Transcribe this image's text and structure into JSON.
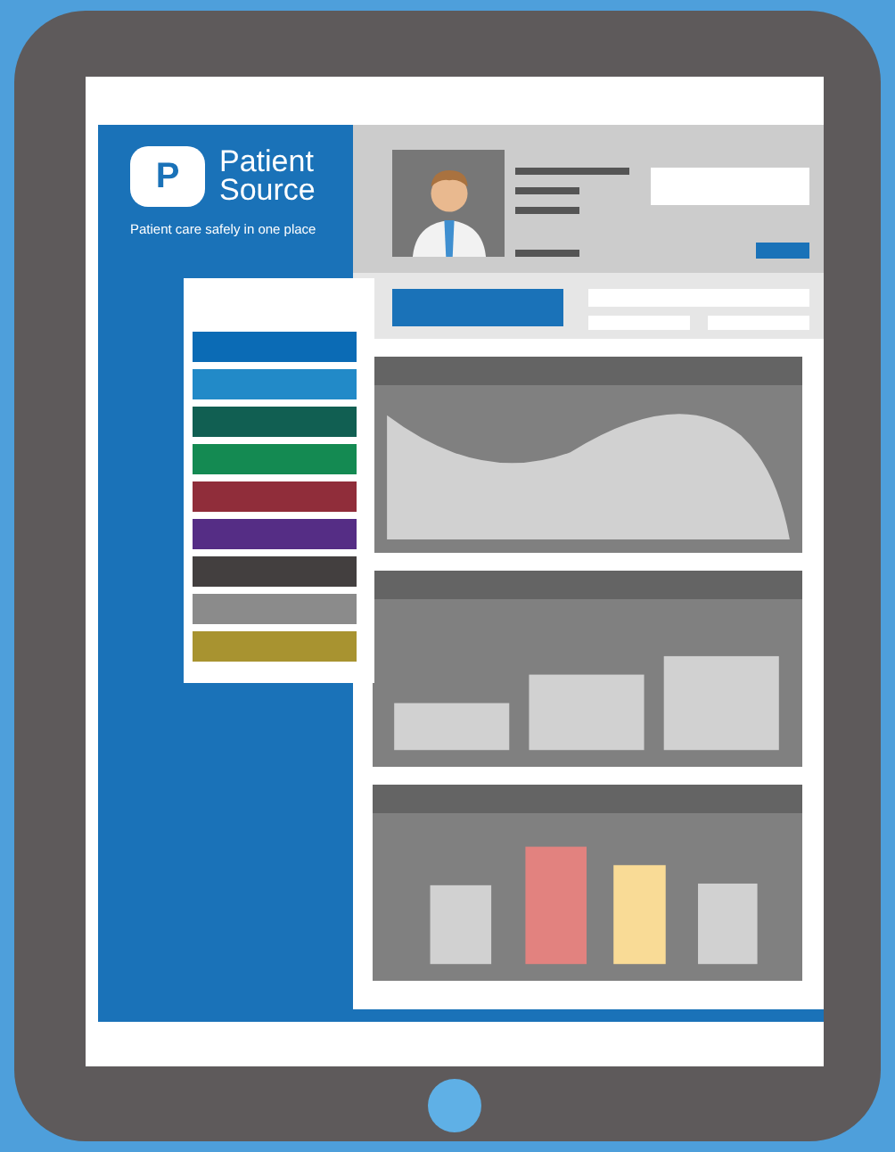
{
  "brand": {
    "logo_letter": "P",
    "name_line1": "Patient",
    "name_line2": "Source",
    "tagline": "Patient care safely in one place"
  },
  "swatches": [
    {
      "color": "#0b6bb5"
    },
    {
      "color": "#228ac8"
    },
    {
      "color": "#115f52"
    },
    {
      "color": "#148a52"
    },
    {
      "color": "#902d3a"
    },
    {
      "color": "#552d85"
    },
    {
      "color": "#433f3f"
    },
    {
      "color": "#8b8b8b"
    },
    {
      "color": "#a89330"
    }
  ]
}
